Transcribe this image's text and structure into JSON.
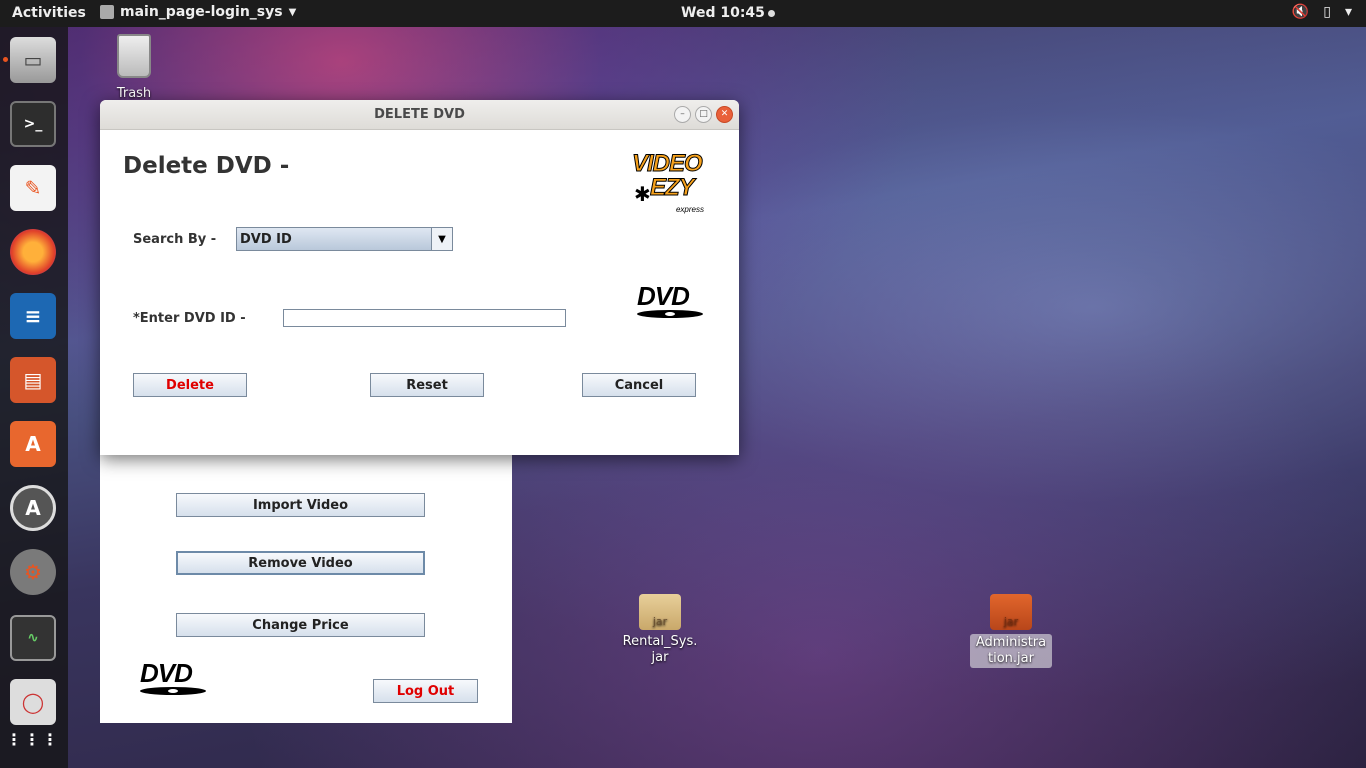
{
  "topbar": {
    "activities": "Activities",
    "app_name": "main_page-login_sys",
    "clock": "Wed 10:45"
  },
  "desktop": {
    "trash_label": "Trash",
    "jar1_label": "Rental_Sys.\njar",
    "jar1_badge": "jar",
    "jar2_label": "Administra\ntion.jar",
    "jar2_badge": "jar"
  },
  "dialog": {
    "title": "DELETE DVD",
    "heading": "Delete DVD -",
    "search_by_label": "Search By -",
    "search_by_value": "DVD ID",
    "enter_id_label": "*Enter DVD ID -",
    "enter_id_value": "",
    "delete_button": "Delete",
    "reset_button": "Reset",
    "cancel_button": "Cancel",
    "logo_line1": "VIDEO",
    "logo_line2": "EZY",
    "logo_sub": "express",
    "dvd_logo": "DVD"
  },
  "main_window": {
    "import_button": "Import Video",
    "remove_button": "Remove Video",
    "change_price_button": "Change Price",
    "logout_button": "Log Out",
    "dvd_logo": "DVD"
  },
  "dock": {
    "items": [
      "files-icon",
      "terminal-icon",
      "text-editor-icon",
      "firefox-icon",
      "writer-icon",
      "impress-icon",
      "software-icon",
      "updater-icon",
      "settings-icon",
      "system-monitor-icon",
      "app-icon",
      "show-apps-icon"
    ]
  }
}
